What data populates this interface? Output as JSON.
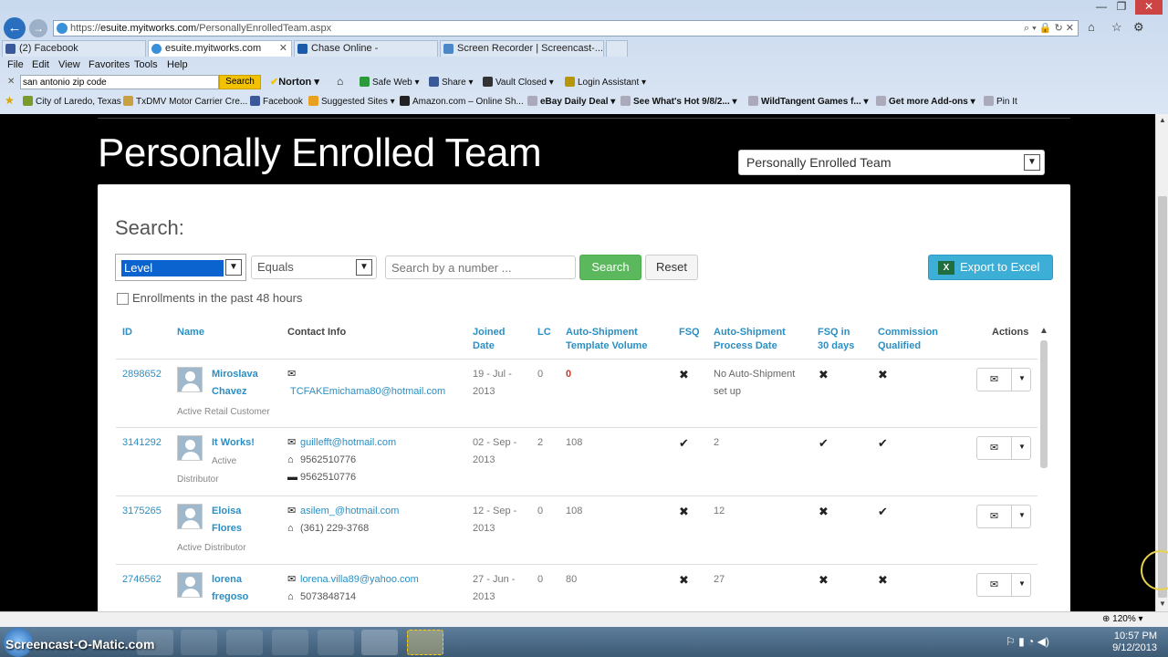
{
  "browser": {
    "url_prefix": "https://",
    "url_domain": "esuite.myitworks.com",
    "url_path": "/PersonallyEnrolledTeam.aspx",
    "tabs": [
      {
        "label": "(2) Facebook",
        "color": "#3b5998"
      },
      {
        "label": "esuite.myitworks.com",
        "color": "#3a8fd9"
      },
      {
        "label": "Chase Online -",
        "color": "#1a5aa8"
      },
      {
        "label": "Screen Recorder | Screencast-...",
        "color": "#4a88c8"
      }
    ],
    "menu": [
      "File",
      "Edit",
      "View",
      "Favorites",
      "Tools",
      "Help"
    ],
    "toolbar": {
      "search_value": "san antonio zip code",
      "search_button": "Search",
      "norton": "Norton",
      "safe_web": "Safe Web",
      "share": "Share",
      "vault": "Vault Closed",
      "login": "Login Assistant"
    },
    "favorites": [
      "City of Laredo, Texas",
      "TxDMV Motor Carrier Cre...",
      "Facebook",
      "Suggested Sites",
      "Amazon.com – Online Sh...",
      "eBay Daily Deal",
      "See What's Hot 9/8/2...",
      "WildTangent Games f...",
      "Get more Add-ons",
      "Pin It"
    ]
  },
  "page": {
    "title": "Personally Enrolled Team",
    "team_select": "Personally Enrolled Team",
    "search_label": "Search:",
    "level_select": "Level",
    "equals_select": "Equals",
    "number_placeholder": "Search by a number ...",
    "search_btn": "Search",
    "reset_btn": "Reset",
    "export_btn": "Export to Excel",
    "enroll_chk": "Enrollments in the past 48 hours",
    "headers": {
      "id": "ID",
      "name": "Name",
      "contact": "Contact Info",
      "joined1": "Joined",
      "joined2": "Date",
      "lc": "LC",
      "ast1": "Auto-Shipment",
      "ast2": "Template Volume",
      "fsq": "FSQ",
      "asp1": "Auto-Shipment",
      "asp2": "Process Date",
      "fsq30a": "FSQ in",
      "fsq30b": "30 days",
      "cq1": "Commission",
      "cq2": "Qualified",
      "actions": "Actions"
    },
    "rows": [
      {
        "id": "2898652",
        "name1": "Miroslava",
        "name2": "Chavez",
        "status": "Active Retail Customer",
        "email": "TCFAKEmichama80@hotmail.com",
        "phone": "",
        "work": "",
        "joined1": "19 - Jul -",
        "joined2": "2013",
        "lc": "0",
        "volume": "0",
        "fsq": "✖",
        "process1": "No Auto-Shipment",
        "process2": "set up",
        "fsq30": "✖",
        "cq": "✖"
      },
      {
        "id": "3141292",
        "name1": "It Works!",
        "name2": "",
        "status1": "Active",
        "status": "Distributor",
        "email": "guillefft@hotmail.com",
        "phone": "9562510776",
        "work": "9562510776",
        "joined1": "02 - Sep -",
        "joined2": "2013",
        "lc": "2",
        "volume": "108",
        "fsq": "✔",
        "process1": "2",
        "process2": "",
        "fsq30": "✔",
        "cq": "✔"
      },
      {
        "id": "3175265",
        "name1": "Eloisa",
        "name2": "Flores",
        "status": "Active Distributor",
        "email": "asilem_@hotmail.com",
        "phone": "(361) 229-3768",
        "work": "",
        "joined1": "12 - Sep -",
        "joined2": "2013",
        "lc": "0",
        "volume": "108",
        "fsq": "✖",
        "process1": "12",
        "process2": "",
        "fsq30": "✖",
        "cq": "✔"
      },
      {
        "id": "2746562",
        "name1": "lorena",
        "name2": "fregoso",
        "status": "",
        "email": "lorena.villa89@yahoo.com",
        "phone": "5073848714",
        "work": "",
        "joined1": "27 - Jun -",
        "joined2": "2013",
        "lc": "0",
        "volume": "80",
        "fsq": "✖",
        "process1": "27",
        "process2": "",
        "fsq30": "✖",
        "cq": "✖"
      }
    ]
  },
  "statusbar": {
    "zoom": "120%"
  },
  "taskbar": {
    "watermark": "Screencast-O-Matic.com",
    "time": "10:57 PM",
    "date": "9/12/2013"
  },
  "colors": {
    "accent": "#2a8fc4",
    "search_green": "#5cb85c",
    "export_blue": "#3daed6"
  }
}
